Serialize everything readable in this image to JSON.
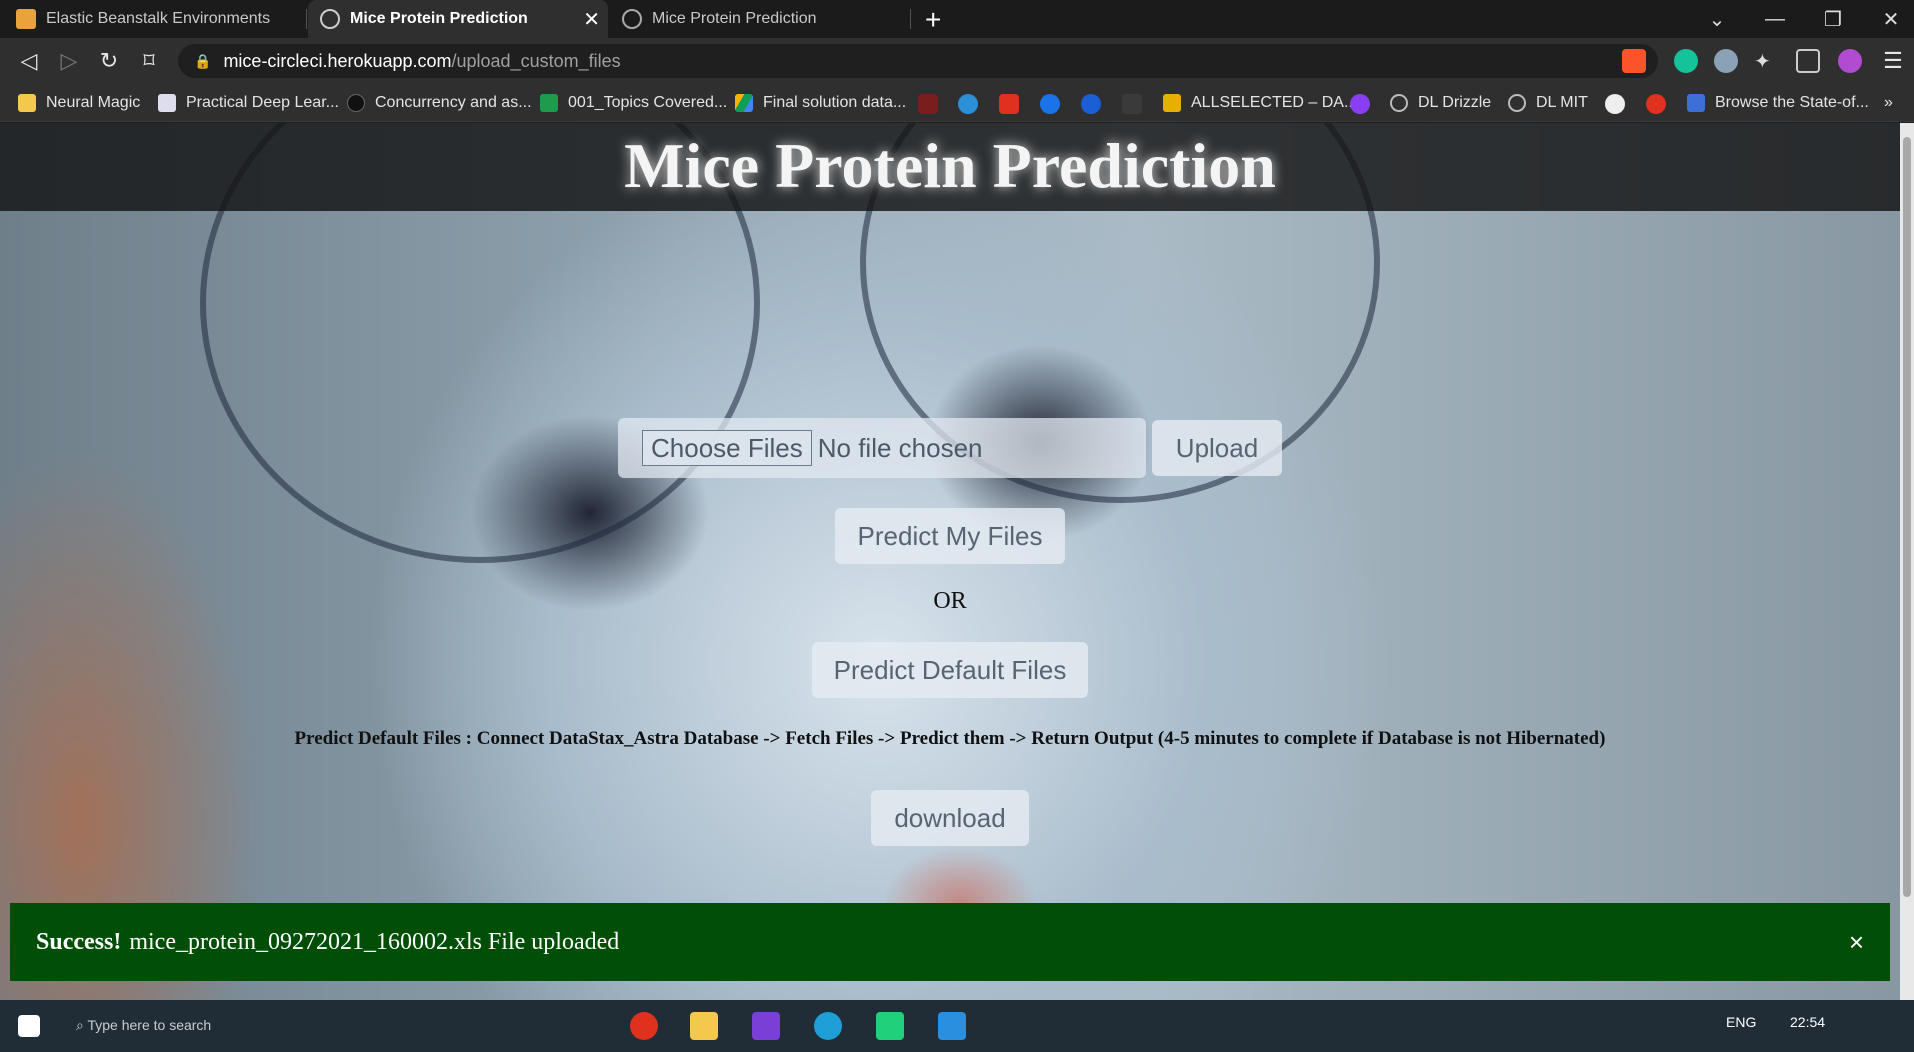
{
  "tabs": [
    {
      "label": "Elastic Beanstalk Environments",
      "icon": "box-icon"
    },
    {
      "label": "Mice Protein Prediction",
      "icon": "globe-icon",
      "active": true
    },
    {
      "label": "Mice Protein Prediction",
      "icon": "globe-icon"
    }
  ],
  "address": {
    "host": "mice-circleci.herokuapp.com",
    "path": "/upload_custom_files"
  },
  "bookmarks": [
    {
      "label": "Neural Magic",
      "icon": "folder-icon"
    },
    {
      "label": "Practical Deep Lear...",
      "icon": "page-icon"
    },
    {
      "label": "Concurrency and as...",
      "icon": "circle-icon"
    },
    {
      "label": "001_Topics Covered...",
      "icon": "plus-icon"
    },
    {
      "label": "Final solution data...",
      "icon": "drive-icon"
    },
    {
      "label": "ALLSELECTED – DA...",
      "icon": "bars-icon"
    },
    {
      "label": "DL Drizzle",
      "icon": "globe-icon"
    },
    {
      "label": "DL MIT",
      "icon": "globe-icon"
    },
    {
      "label": "Browse the State-of...",
      "icon": "chart-icon"
    }
  ],
  "bookmarks_more": "»",
  "page": {
    "title": "Mice Protein Prediction",
    "choose_files": "Choose Files",
    "file_status": "No file chosen",
    "upload": "Upload",
    "predict_my_files": "Predict My Files",
    "or": "OR",
    "predict_default_files": "Predict Default Files",
    "description": "Predict Default Files : Connect DataStax_Astra Database -> Fetch Files -> Predict them -> Return Output (4-5 minutes to complete if Database is not Hibernated)",
    "download": "download"
  },
  "alert": {
    "strong": "Success!",
    "message": "mice_protein_09272021_160002.xls File uploaded",
    "close": "×"
  },
  "taskbar": {
    "search_placeholder": "Type here to search",
    "language": "ENG",
    "time": "22:54"
  },
  "colors": {
    "alert_bg": "#014f06",
    "footer_bar": "#0a2e55",
    "accent_brave": "#fb542b"
  }
}
